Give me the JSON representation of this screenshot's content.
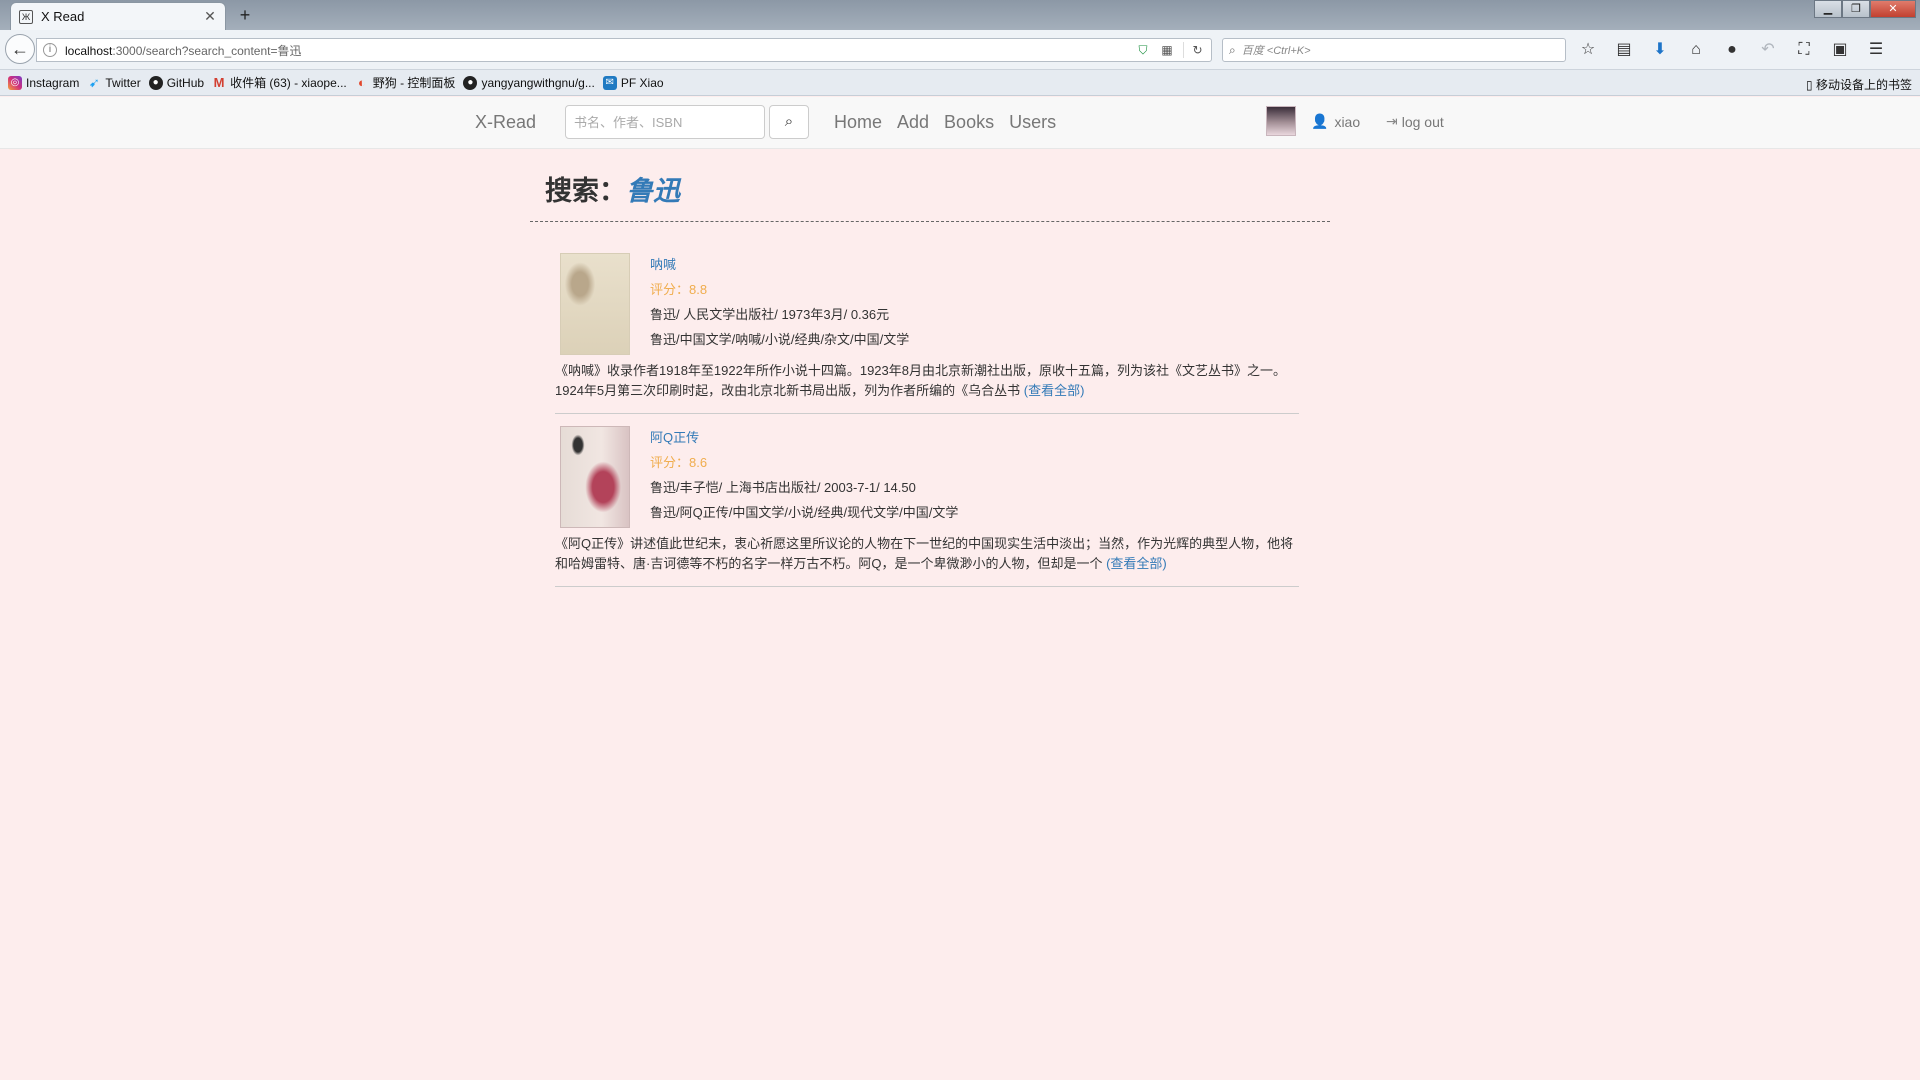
{
  "browser": {
    "tab_title": "X Read",
    "tab_favicon": "Ж",
    "new_tab": "+",
    "url_host": "localhost",
    "url_rest": ":3000/search?search_content=鲁迅",
    "search_placeholder": "百度 <Ctrl+K>",
    "bookmarks": [
      {
        "label": "Instagram",
        "icon": "instagram-icon"
      },
      {
        "label": "Twitter",
        "icon": "twitter-icon"
      },
      {
        "label": "GitHub",
        "icon": "github-icon"
      },
      {
        "label": "收件箱 (63) - xiaope...",
        "icon": "gmail-icon"
      },
      {
        "label": "野狗 - 控制面板",
        "icon": "wilddog-icon"
      },
      {
        "label": "yangyangwithgnu/g...",
        "icon": "github-icon"
      },
      {
        "label": "PF Xiao",
        "icon": "pf-icon"
      }
    ],
    "mobile_bookmarks": "移动设备上的书签"
  },
  "site": {
    "brand": "X-Read",
    "search_placeholder": "书名、作者、ISBN",
    "nav": [
      "Home",
      "Add",
      "Books",
      "Users"
    ],
    "username": "xiao",
    "logout": "log out"
  },
  "search": {
    "label": "搜索：",
    "keyword": "鲁迅"
  },
  "results": [
    {
      "title": "呐喊",
      "rating": "评分：8.8",
      "pub": "鲁迅/ 人民文学出版社/ 1973年3月/ 0.36元",
      "tags": "鲁迅/中国文学/呐喊/小说/经典/杂文/中国/文学",
      "desc": "《呐喊》收录作者1918年至1922年所作小说十四篇。1923年8月由北京新潮社出版，原收十五篇，列为该社《文艺丛书》之一。1924年5月第三次印刷时起，改由北京北新书局出版，列为作者所编的《乌合丛书",
      "more": "(查看全部)"
    },
    {
      "title": "阿Q正传",
      "rating": "评分：8.6",
      "pub": "鲁迅/丰子恺/ 上海书店出版社/ 2003-7-1/ 14.50",
      "tags": "鲁迅/阿Q正传/中国文学/小说/经典/现代文学/中国/文学",
      "desc": "《阿Q正传》讲述值此世纪末，衷心祈愿这里所议论的人物在下一世纪的中国现实生活中淡出；当然，作为光辉的典型人物，他将和哈姆雷特、唐·吉诃德等不朽的名字一样万古不朽。阿Q，是一个卑微渺小的人物，但却是一个",
      "more": "(查看全部)"
    }
  ],
  "colors": {
    "page_bg": "#fdeded",
    "link": "#337ab7",
    "rating": "#f0ad4e"
  }
}
